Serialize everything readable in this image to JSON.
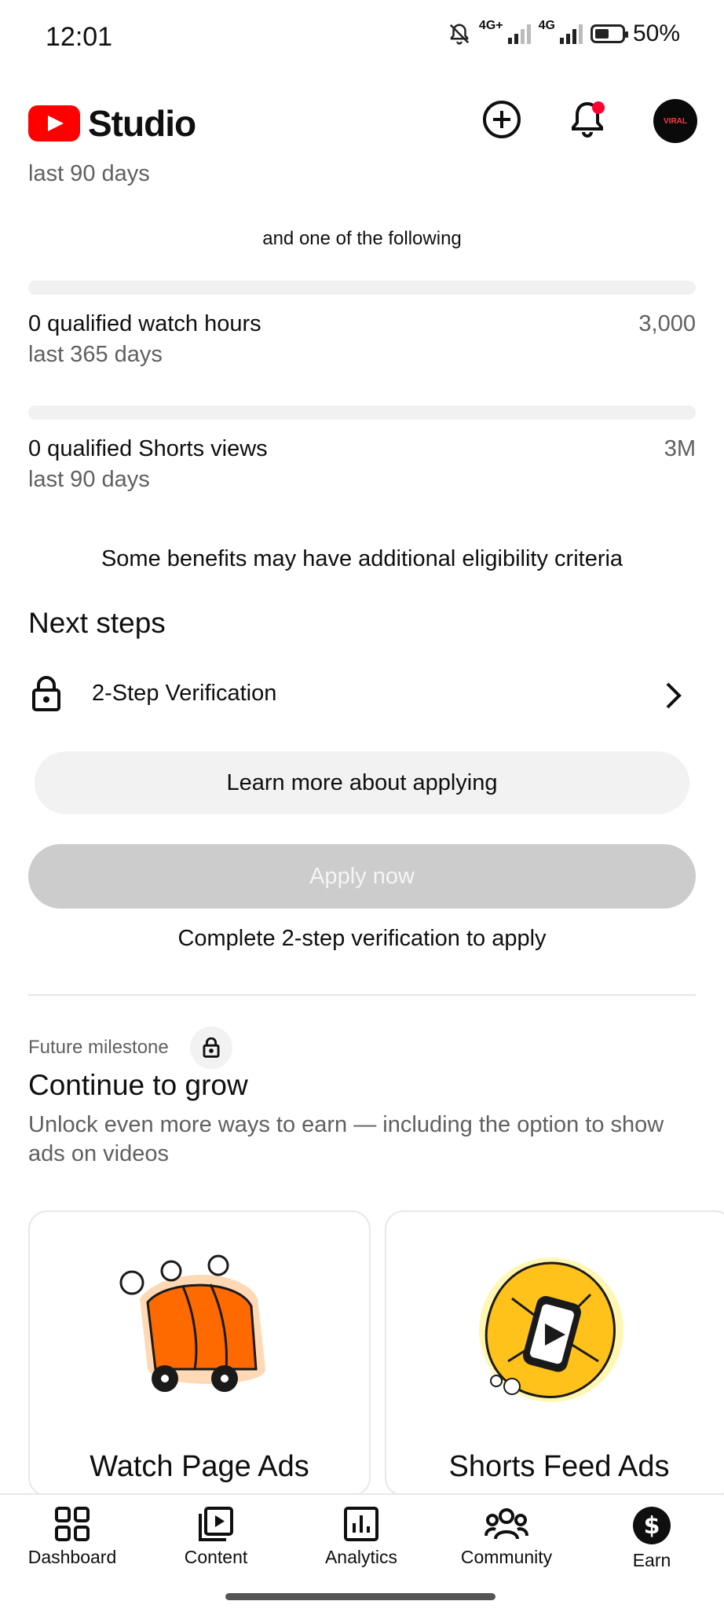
{
  "status_bar": {
    "time": "12:01",
    "net1": "4G+",
    "net2": "4G",
    "battery": "50%"
  },
  "header": {
    "app_name": "Studio",
    "avatar_text": "VIRAL"
  },
  "requirements": {
    "prev_period": "last 90 days",
    "or_text": "and one of the following",
    "watch_hours": {
      "label": "0 qualified watch hours",
      "period": "last 365 days",
      "target": "3,000",
      "progress": 0
    },
    "shorts_views": {
      "label": "0 qualified Shorts views",
      "period": "last 90 days",
      "target": "3M",
      "progress": 0
    },
    "benefits_note": "Some benefits may have additional eligibility criteria"
  },
  "next_steps": {
    "title": "Next steps",
    "items": [
      {
        "label": "2-Step Verification",
        "icon": "lock-icon"
      }
    ],
    "learn_more_label": "Learn more about applying",
    "apply_label": "Apply now",
    "apply_note": "Complete 2-step verification to apply"
  },
  "milestone": {
    "tag": "Future milestone",
    "title": "Continue to grow",
    "description": "Unlock even more ways to earn — including the option to show ads on videos",
    "cards": [
      {
        "title": "Watch Page Ads",
        "illustration": "orange-cart-illustration"
      },
      {
        "title": "Shorts Feed Ads",
        "illustration": "yellow-phone-illustration"
      }
    ]
  },
  "bottom_nav": {
    "items": [
      {
        "label": "Dashboard",
        "icon": "dashboard-icon"
      },
      {
        "label": "Content",
        "icon": "content-icon"
      },
      {
        "label": "Analytics",
        "icon": "analytics-icon"
      },
      {
        "label": "Community",
        "icon": "community-icon"
      },
      {
        "label": "Earn",
        "icon": "earn-icon"
      }
    ],
    "active": "Earn"
  },
  "colors": {
    "brand_red": "#ff0000",
    "muted_text": "#606060",
    "disabled_button": "#cccccc",
    "notification_dot": "#ff0033"
  }
}
